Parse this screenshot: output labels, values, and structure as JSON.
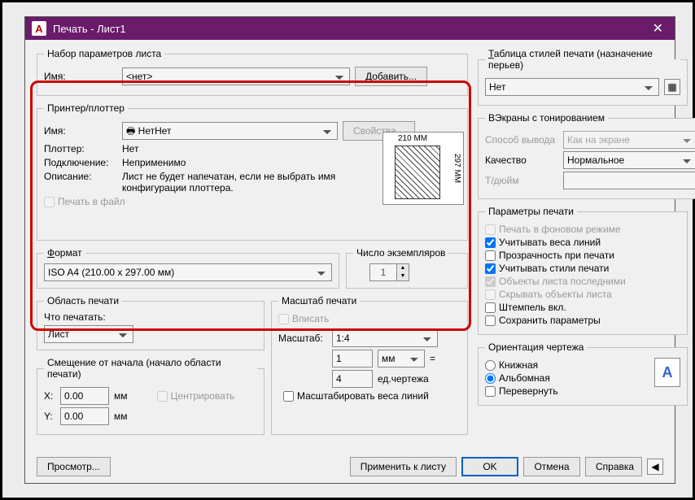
{
  "window": {
    "title": "Печать - Лист1"
  },
  "pageSetup": {
    "legend": "Набор параметров листа",
    "nameLabel": "Имя:",
    "nameValue": "<нет>",
    "addButton": "Добавить..."
  },
  "printer": {
    "legend": "Принтер/плоттер",
    "nameLabel": "Имя:",
    "nameValue": "Нет",
    "propsButton": "Свойства...",
    "plotterLabel": "Плоттер:",
    "plotterValue": "Нет",
    "connectionLabel": "Подключение:",
    "connectionValue": "Неприменимо",
    "descLabel": "Описание:",
    "descValue": "Лист не будет напечатан, если не выбрать имя конфигурации плоттера.",
    "printToFile": "Печать в файл",
    "paperWidth": "210 MM",
    "paperHeight": "297 MM"
  },
  "paper": {
    "legend": "Формат",
    "value": "ISO A4 (210.00 x 297.00 мм)"
  },
  "copies": {
    "legend": "Число экземпляров",
    "value": "1"
  },
  "area": {
    "legend": "Область печати",
    "whatLabel": "Что печатать:",
    "whatValue": "Лист"
  },
  "offset": {
    "legend": "Смещение от начала (начало области печати)",
    "xLabel": "X:",
    "xValue": "0.00",
    "xUnit": "мм",
    "yLabel": "Y:",
    "yValue": "0.00",
    "yUnit": "мм",
    "center": "Центрировать"
  },
  "scale": {
    "legend": "Масштаб печати",
    "fit": "Вписать",
    "scaleLabel": "Масштаб:",
    "scaleValue": "1:4",
    "val1": "1",
    "unit1": "мм",
    "val2": "4",
    "unit2": "ед.чертежа",
    "scaleLineweights": "Масштабировать веса линий"
  },
  "styleTable": {
    "legend": "Таблица стилей печати (назначение перьев)",
    "value": "Нет"
  },
  "shaded": {
    "legend": "ВЭкраны с тонированием",
    "modeLabel": "Способ вывода",
    "modeValue": "Как на экране",
    "qualityLabel": "Качество",
    "qualityValue": "Нормальное",
    "dpiLabel": "Т/дюйм"
  },
  "options": {
    "legend": "Параметры печати",
    "bg": "Печать в фоновом режиме",
    "lineweights": "Учитывать веса линий",
    "transparency": "Прозрачность при печати",
    "styles": "Учитывать стили печати",
    "paperspaceLast": "Объекты листа последними",
    "hide": "Скрывать объекты листа",
    "stamp": "Штемпель вкл.",
    "save": "Сохранить параметры"
  },
  "orient": {
    "legend": "Ориентация чертежа",
    "portrait": "Книжная",
    "landscape": "Альбомная",
    "upside": "Перевернуть"
  },
  "buttons": {
    "preview": "Просмотр...",
    "apply": "Применить к листу",
    "ok": "OK",
    "cancel": "Отмена",
    "help": "Справка"
  }
}
